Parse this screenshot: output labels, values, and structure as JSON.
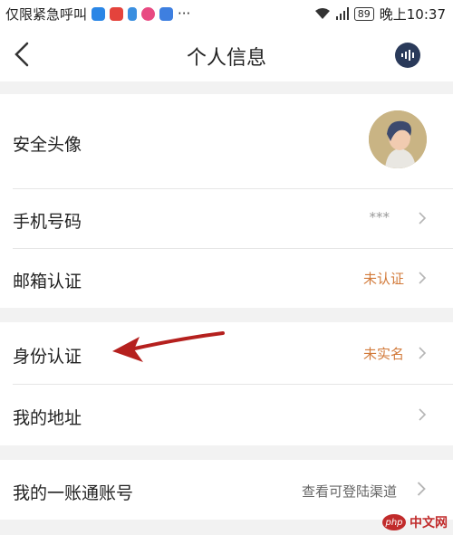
{
  "status_bar": {
    "carrier": "仅限紧急呼叫",
    "more": "···",
    "battery": "89",
    "time": "晚上10:37"
  },
  "header": {
    "title": "个人信息"
  },
  "rows": {
    "avatar": {
      "label": "安全头像"
    },
    "phone": {
      "label": "手机号码",
      "value": "***"
    },
    "email": {
      "label": "邮箱认证",
      "value": "未认证"
    },
    "identity": {
      "label": "身份认证",
      "value": "未实名"
    },
    "address": {
      "label": "我的地址"
    },
    "account": {
      "label": "我的一账通账号",
      "value": "查看可登陆渠道"
    }
  },
  "watermark": {
    "badge": "php",
    "text": "中文网"
  },
  "colors": {
    "warn": "#d27a3a",
    "arrow": "#b5201e",
    "background": "#f2f2f2"
  }
}
